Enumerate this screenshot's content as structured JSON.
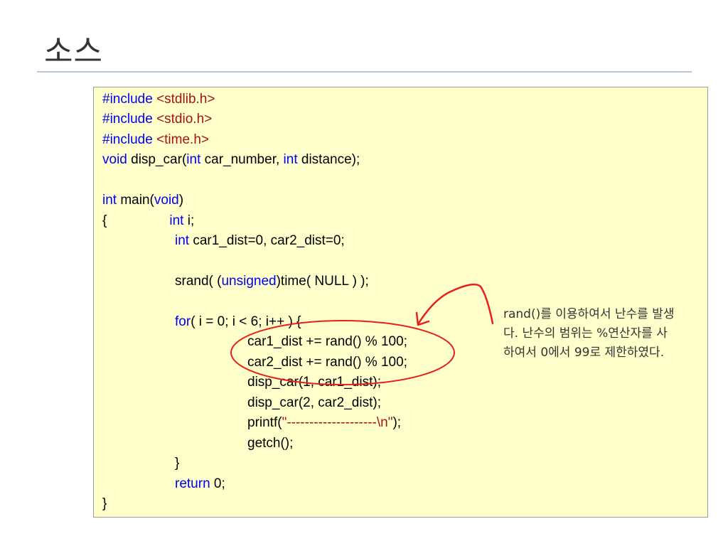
{
  "slide": {
    "title": "소스"
  },
  "code": {
    "lines": [
      [
        {
          "t": "#include ",
          "c": "kw"
        },
        {
          "t": "<stdlib.h>",
          "c": "str"
        }
      ],
      [
        {
          "t": "#include ",
          "c": "kw"
        },
        {
          "t": "<stdio.h>",
          "c": "str"
        }
      ],
      [
        {
          "t": "#include ",
          "c": "kw"
        },
        {
          "t": "<time.h>",
          "c": "str"
        }
      ],
      [
        {
          "t": "void",
          "c": "kw"
        },
        {
          "t": " disp_car("
        },
        {
          "t": "int",
          "c": "kw"
        },
        {
          "t": " car_number, "
        },
        {
          "t": "int",
          "c": "kw"
        },
        {
          "t": " distance);"
        }
      ],
      [],
      [
        {
          "t": "int",
          "c": "kw"
        },
        {
          "t": " main("
        },
        {
          "t": "void",
          "c": "kw"
        },
        {
          "t": ")"
        }
      ],
      [
        {
          "t": "{"
        },
        {
          "tab": 1
        },
        {
          "t": "int",
          "c": "kw"
        },
        {
          "t": " i;"
        }
      ],
      [
        {
          "tab": 1
        },
        {
          "t": "int",
          "c": "kw"
        },
        {
          "t": " car1_dist=0, car2_dist=0;"
        }
      ],
      [],
      [
        {
          "tab": 1
        },
        {
          "t": "srand( ("
        },
        {
          "t": "unsigned",
          "c": "kw"
        },
        {
          "t": ")time( NULL ) );"
        }
      ],
      [],
      [
        {
          "tab": 1
        },
        {
          "t": "for",
          "c": "kw"
        },
        {
          "t": "( i = 0; i < 6; i++ ) {"
        }
      ],
      [
        {
          "tab": 2
        },
        {
          "t": "car1_dist += rand() % 100;"
        }
      ],
      [
        {
          "tab": 2
        },
        {
          "t": "car2_dist += rand() % 100;"
        }
      ],
      [
        {
          "tab": 2
        },
        {
          "t": "disp_car(1, car1_dist);"
        }
      ],
      [
        {
          "tab": 2
        },
        {
          "t": "disp_car(2, car2_dist);"
        }
      ],
      [
        {
          "tab": 2
        },
        {
          "t": "printf("
        },
        {
          "t": "\"--------------------\\n\"",
          "c": "str"
        },
        {
          "t": ");"
        }
      ],
      [
        {
          "tab": 2
        },
        {
          "t": "getch();"
        }
      ],
      [
        {
          "tab": 1
        },
        {
          "t": "}"
        }
      ],
      [
        {
          "tab": 1
        },
        {
          "t": "return",
          "c": "kw"
        },
        {
          "t": " 0;"
        }
      ],
      [
        {
          "t": "}"
        }
      ]
    ]
  },
  "annotation": {
    "lines": [
      "rand()를 이용하여서 난수를 발생",
      "다. 난수의 범위는 %연산자를 사",
      "하여서 0에서 99로 제한하였다."
    ]
  },
  "colors": {
    "keyword": "#0000ee",
    "string": "#a31515",
    "code_background": "#ffffcc",
    "highlight_ellipse": "#e8201b",
    "title_rule": "#b6c7dc"
  }
}
